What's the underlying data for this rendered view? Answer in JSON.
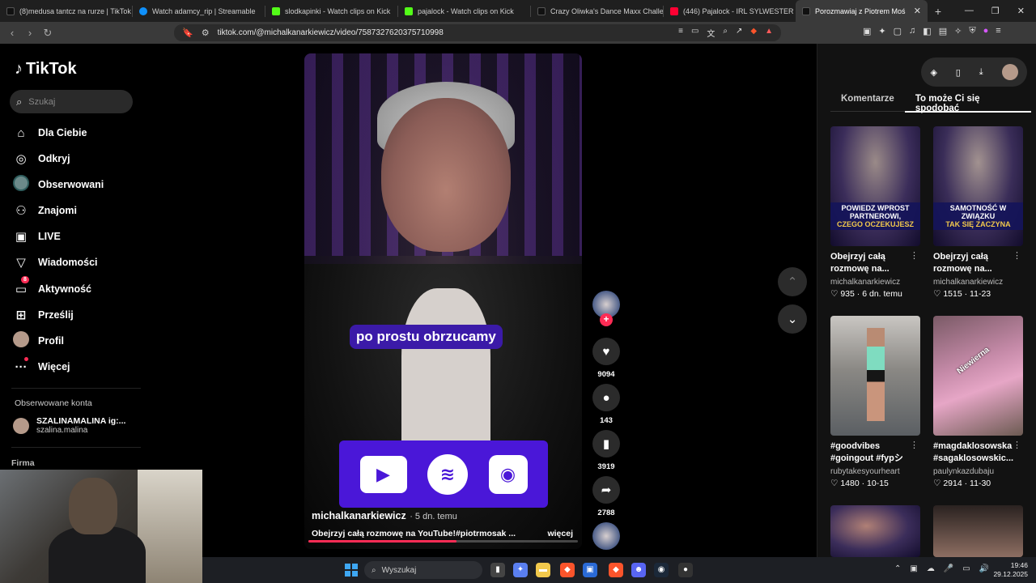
{
  "browser": {
    "tabs": [
      {
        "label": "(8)medusa tantcz na rurze | TikTok",
        "favicon": "tiktok-icon",
        "active": false
      },
      {
        "label": "Watch adamcy_rip | Streamable",
        "favicon": "streamable-icon",
        "active": false
      },
      {
        "label": "slodkapinki - Watch clips on Kick",
        "favicon": "kick-icon",
        "active": false
      },
      {
        "label": "pajalock - Watch clips on Kick",
        "favicon": "kick-icon",
        "active": false
      },
      {
        "label": "Crazy Oliwka's Dance Maxx Challeng",
        "favicon": "tiktok-icon",
        "active": false
      },
      {
        "label": "(446) Pajalock - IRL SYLWESTER Z PA",
        "favicon": "youtube-icon",
        "active": false
      },
      {
        "label": "Porozmawiaj z Piotrem Moś",
        "favicon": "tiktok-icon",
        "active": true
      }
    ],
    "url": "tiktok.com/@michalkanarkiewicz/video/7587327620375710998",
    "brave_badge": "6"
  },
  "sidebar": {
    "logo": "TikTok",
    "search_placeholder": "Szukaj",
    "items": [
      {
        "label": "Dla Ciebie",
        "icon": "home-icon"
      },
      {
        "label": "Odkryj",
        "icon": "compass-icon"
      },
      {
        "label": "Obserwowani",
        "icon": "following-avatar-icon"
      },
      {
        "label": "Znajomi",
        "icon": "friends-icon"
      },
      {
        "label": "LIVE",
        "icon": "live-icon"
      },
      {
        "label": "Wiadomości",
        "icon": "messages-icon"
      },
      {
        "label": "Aktywność",
        "icon": "activity-icon",
        "badge": "8"
      },
      {
        "label": "Prześlij",
        "icon": "upload-icon"
      },
      {
        "label": "Profil",
        "icon": "profile-avatar-icon"
      },
      {
        "label": "Więcej",
        "icon": "more-icon"
      }
    ],
    "followed_title": "Obserwowane konta",
    "followed_account": {
      "name": "SZALINAMALINA ig:...",
      "handle": "szalina.malina"
    },
    "company_title": "Firma"
  },
  "video": {
    "caption": "po prostu obrzucamy",
    "author": "michalkanarkiewicz",
    "age": "· 5 dn. temu",
    "description": "Obejrzyj całą rozmowę na YouTube!#piotrmosak ...",
    "more_label": "więcej",
    "progress": 0.55,
    "likes": "9094",
    "comments": "143",
    "saves": "3919",
    "shares": "2788"
  },
  "right_panel": {
    "tabs": [
      "Komentarze",
      "To może Ci się spodobać"
    ],
    "active_tab": 1,
    "cards": [
      {
        "title": "Obejrzyj całą rozmowę na...",
        "author": "michalkanarkiewicz",
        "likes": "935",
        "date": "6 dn. temu",
        "overlay": [
          "POWIEDZ WPROST",
          "PARTNEROWI,"
        ],
        "overlay_hl": "CZEGO OCZEKUJESZ"
      },
      {
        "title": "Obejrzyj całą rozmowę na...",
        "author": "michalkanarkiewicz",
        "likes": "1515",
        "date": "11-23",
        "overlay": [
          "SAMOTNOŚĆ W",
          "ZWIĄZKU"
        ],
        "overlay_hl": "TAK SIĘ ZACZYNA"
      },
      {
        "title": "#goodvibes #goingout #fypシ",
        "author": "rubytakesyourheart",
        "likes": "1480",
        "date": "10-15",
        "overlay": [],
        "overlay_hl": ""
      },
      {
        "title": "#magdaklosowska #sagaklosowskic...",
        "author": "paulynkazdubaju",
        "likes": "2914",
        "date": "11-30",
        "overlay": [
          "Niewierna"
        ],
        "overlay_hl": ""
      }
    ]
  },
  "taskbar": {
    "search_placeholder": "Wyszukaj",
    "time": "19:46",
    "date": "29.12.2025"
  },
  "colors": {
    "accent": "#fe2c55",
    "promo": "#4a17d8",
    "caption_bg": "#3b1aa8"
  }
}
